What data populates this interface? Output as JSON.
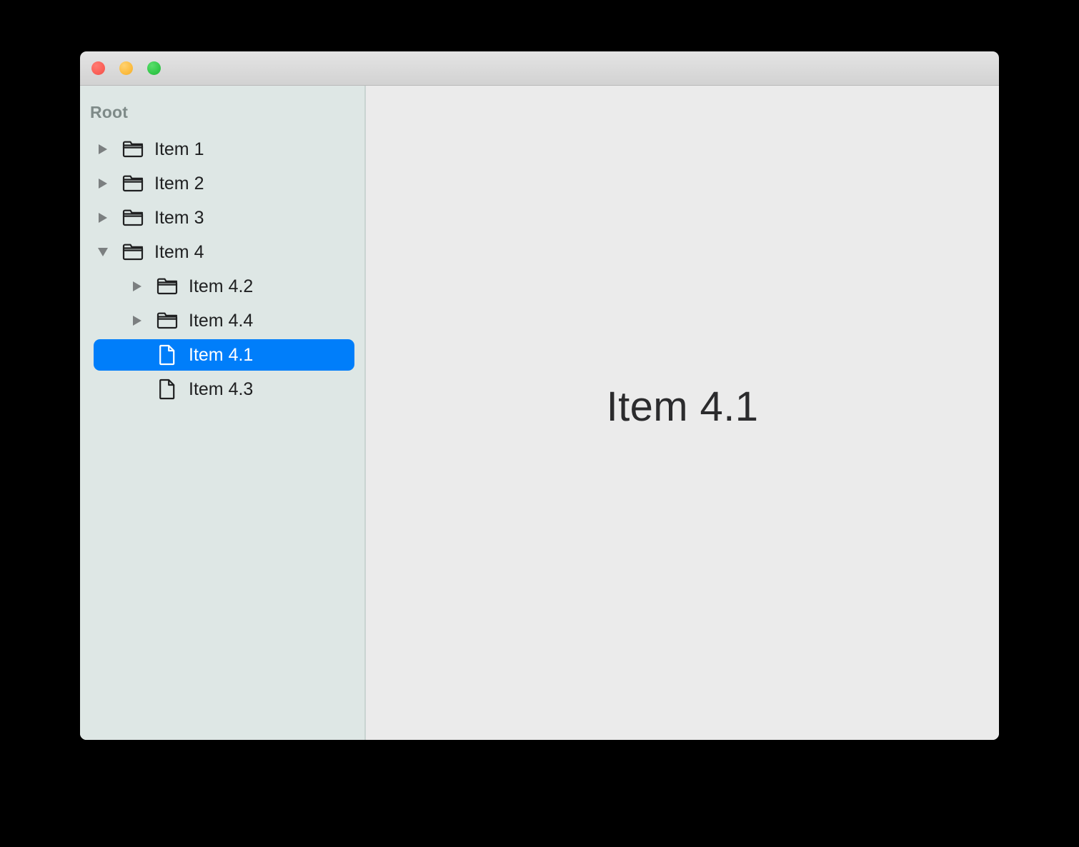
{
  "window": {
    "traffic_lights": [
      {
        "name": "close-button",
        "color": "#fb6058"
      },
      {
        "name": "minimize-button",
        "color": "#fcbc40"
      },
      {
        "name": "zoom-button",
        "color": "#34c94a"
      }
    ],
    "titlebar_color": "#dcdcdc"
  },
  "sidebar": {
    "background": "#dee7e5",
    "root_label": "Root",
    "selection_color": "#007efa",
    "tree": [
      {
        "label": "Item 1",
        "depth": 1,
        "icon": "folder-icon",
        "twisty": "collapsed",
        "selected": false
      },
      {
        "label": "Item 2",
        "depth": 1,
        "icon": "folder-icon",
        "twisty": "collapsed",
        "selected": false
      },
      {
        "label": "Item 3",
        "depth": 1,
        "icon": "folder-icon",
        "twisty": "collapsed",
        "selected": false
      },
      {
        "label": "Item 4",
        "depth": 1,
        "icon": "folder-icon",
        "twisty": "expanded",
        "selected": false
      },
      {
        "label": "Item 4.2",
        "depth": 2,
        "icon": "folder-icon",
        "twisty": "collapsed",
        "selected": false
      },
      {
        "label": "Item 4.4",
        "depth": 2,
        "icon": "folder-icon",
        "twisty": "collapsed",
        "selected": false
      },
      {
        "label": "Item 4.1",
        "depth": 2,
        "icon": "file-icon",
        "twisty": "none",
        "selected": true
      },
      {
        "label": "Item 4.3",
        "depth": 2,
        "icon": "file-icon",
        "twisty": "none",
        "selected": false
      }
    ]
  },
  "content": {
    "title": "Item 4.1",
    "background": "#ebebeb"
  }
}
